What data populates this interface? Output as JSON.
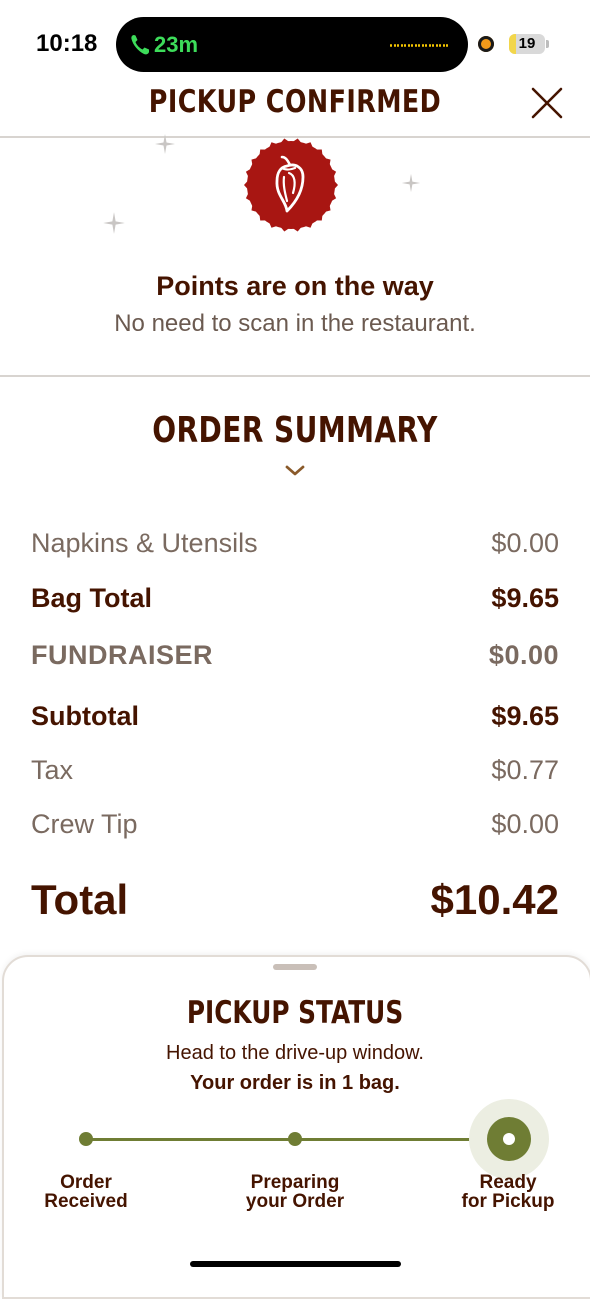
{
  "status_bar": {
    "time": "10:18",
    "call_duration": "23m",
    "battery": "19",
    "battery_level": 0.19,
    "call_color": "#3ddc5a"
  },
  "header": {
    "title": "PICKUP CONFIRMED",
    "close_icon": "close-icon"
  },
  "rewards": {
    "badge_icon": "pepper-badge-icon",
    "title": "Points are on the way",
    "subtitle": "No need to scan in the restaurant."
  },
  "order_summary": {
    "title": "ORDER SUMMARY",
    "toggle_icon": "chevron-down-icon",
    "rows": [
      {
        "label": "Napkins & Utensils",
        "value": "$0.00"
      },
      {
        "label": "Bag Total",
        "value": "$9.65"
      },
      {
        "label": "FUNDRAISER",
        "value": "$0.00"
      },
      {
        "label": "Subtotal",
        "value": "$9.65"
      },
      {
        "label": "Tax",
        "value": "$0.77"
      },
      {
        "label": "Crew Tip",
        "value": "$0.00"
      }
    ],
    "total": {
      "label": "Total",
      "value": "$10.42"
    }
  },
  "pickup_status": {
    "title": "PICKUP STATUS",
    "instruction": "Head to the drive-up window.",
    "bag_note": "Your order is in 1 bag.",
    "steps": [
      {
        "line1": "Order",
        "line2": "Received"
      },
      {
        "line1": "Preparing",
        "line2": "your Order"
      },
      {
        "line1": "Ready",
        "line2": "for Pickup"
      }
    ],
    "active_step": 3,
    "accent_color": "#6f7d34"
  },
  "colors": {
    "brand_brown": "#451400",
    "brand_red": "#a81612",
    "muted_text": "#7a6a60"
  }
}
